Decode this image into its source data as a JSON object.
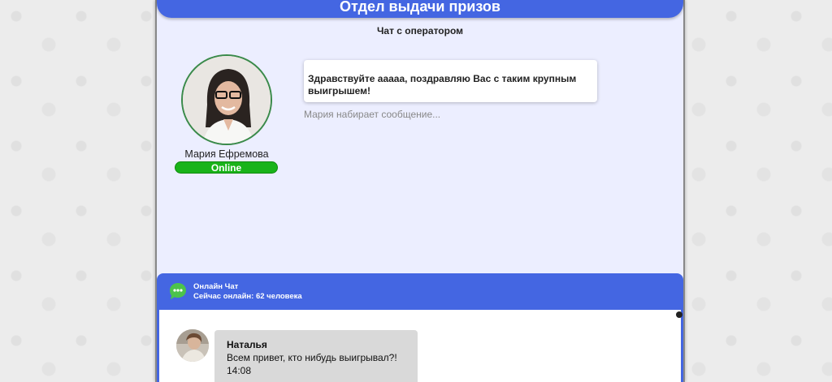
{
  "header": {
    "title": "Отдел выдачи призов"
  },
  "chat": {
    "title": "Чат с оператором"
  },
  "operator": {
    "name": "Мария Ефремова",
    "status": "Online",
    "avatar_icon": "operator-photo"
  },
  "message": {
    "text": "Здравствуйте ааааа, поздравляю Вас с таким крупным выигрышем!"
  },
  "typing": {
    "text": "Мария набирает сообщение..."
  },
  "online_chat": {
    "title": "Онлайн Чат",
    "online_label": "Сейчас онлайн: ",
    "online_count": "62 человека",
    "icon": "chat-bubble-icon",
    "messages": [
      {
        "author": "Наталья",
        "text": "Всем привет, кто нибудь выигрывал?!",
        "time": "14:08"
      }
    ]
  },
  "colors": {
    "accent": "#4466e2",
    "online": "#19b319",
    "panel_bg": "#eceeff"
  }
}
